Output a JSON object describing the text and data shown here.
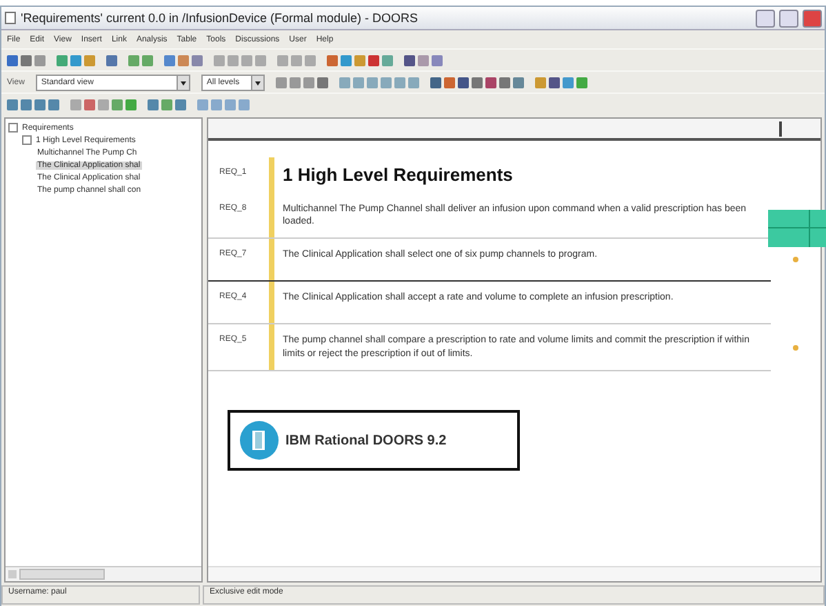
{
  "window": {
    "title": "'Requirements' current 0.0 in /InfusionDevice (Formal module) - DOORS"
  },
  "menu": [
    "File",
    "Edit",
    "View",
    "Insert",
    "Link",
    "Analysis",
    "Table",
    "Tools",
    "Discussions",
    "User",
    "Help"
  ],
  "toolbar": {
    "view_label": "View",
    "view_selector": {
      "value": "Standard view"
    },
    "level_selector": {
      "value": "All levels"
    }
  },
  "tree": {
    "label": "Requirements",
    "expanded": true,
    "selected": false,
    "children": [
      {
        "label": "1 High Level Requirements",
        "expanded": true,
        "selected": false,
        "children": [
          {
            "label": "Multichannel The Pump Ch",
            "selected": false
          },
          {
            "label": "The Clinical Application shal",
            "selected": true
          },
          {
            "label": "The Clinical Application shal",
            "selected": false
          },
          {
            "label": "The pump channel shall con",
            "selected": false
          }
        ]
      }
    ]
  },
  "rows": [
    {
      "kind": "heading",
      "id": "REQ_1",
      "text": "1 High Level Requirements",
      "flagged": false
    },
    {
      "kind": "requirement",
      "id": "REQ_8",
      "text": "Multichannel The Pump Channel shall deliver an infusion upon command when a valid prescription has been loaded.",
      "flagged": false
    },
    {
      "kind": "requirement",
      "id": "REQ_7",
      "text": "The Clinical Application shall select one of six pump channels to program.",
      "flagged": true
    },
    {
      "kind": "requirement",
      "id": "REQ_4",
      "text": "The Clinical Application shall accept a rate and volume to complete an infusion prescription.",
      "flagged": false
    },
    {
      "kind": "requirement",
      "id": "REQ_5",
      "text": "The pump channel shall compare a prescription to rate and volume limits and commit the prescription if within limits or reject the prescription if out of limits.",
      "flagged": true
    }
  ],
  "logo": {
    "text": "IBM Rational DOORS 9.2"
  },
  "status_bar": {
    "user": "Username: paul",
    "mode": "Exclusive edit mode"
  }
}
